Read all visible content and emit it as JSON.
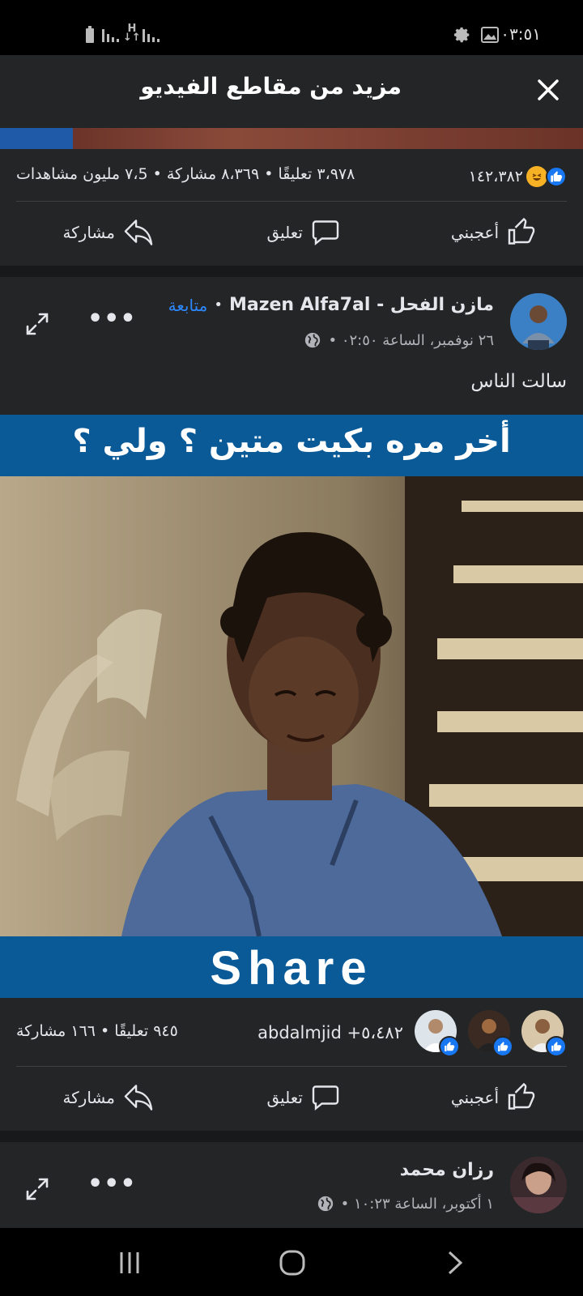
{
  "status_bar": {
    "time": "٠٣:٥١",
    "icons": [
      "battery-icon",
      "signal-icon",
      "data-hplus-icon",
      "signal-icon",
      "gear-icon",
      "image-icon"
    ]
  },
  "header": {
    "title": "مزيد من مقاطع الفيديو",
    "close_icon": "close-icon"
  },
  "video_progress": {
    "fraction": 0.125
  },
  "first_post": {
    "reactions_count": "١٤٢،٣٨٢",
    "stats": "٣،٩٧٨ تعليقًا • ٨،٣٦٩ مشاركة • ٧،5 مليون مشاهدات",
    "actions": {
      "like": "أعجبني",
      "comment": "تعليق",
      "share": "مشاركة"
    }
  },
  "second_post": {
    "author": "مازن الفحل - Mazen Alfa7al",
    "follow": "متابعة",
    "separator": "•",
    "meta": "٢٦ نوفمبر، الساعة ٠٢:٥٠ •",
    "caption": "سالت الناس",
    "video_top_caption": "أخر مره بكيت متين ؟ ولي ؟",
    "video_bottom_caption": "Share",
    "reactors_text": "abdalmjid +٥،٤٨٢",
    "stats": "٩٤٥ تعليقًا • ١٦٦ مشاركة",
    "actions": {
      "like": "أعجبني",
      "comment": "تعليق",
      "share": "مشاركة"
    }
  },
  "third_post": {
    "author": "رزان محمد",
    "meta": "١ أكتوبر، الساعة ١٠:٢٣ •"
  },
  "colors": {
    "background": "#242526",
    "gap": "#18191a",
    "accent": "#2d88ff",
    "video_banner": "#0a5a98",
    "like_blue": "#1877f2"
  }
}
